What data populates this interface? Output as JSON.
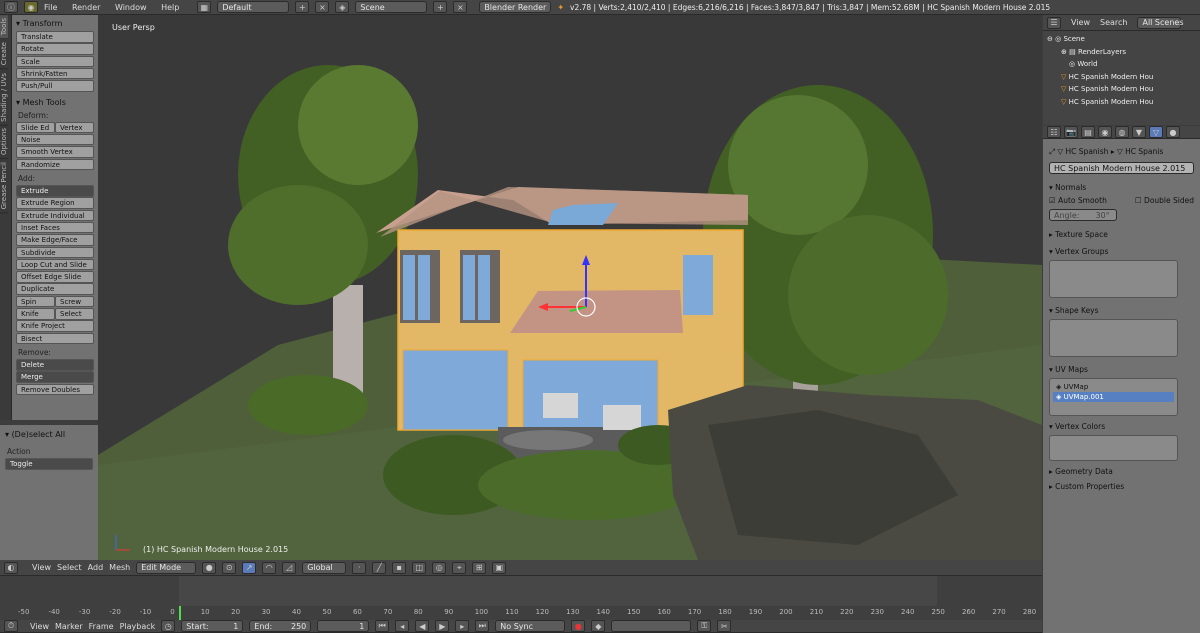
{
  "top": {
    "menus": [
      "File",
      "Render",
      "Window",
      "Help"
    ],
    "layout": "Default",
    "scene": "Scene",
    "engine": "Blender Render",
    "status": "v2.78 | Verts:2,410/2,410 | Edges:6,216/6,216 | Faces:3,847/3,847 | Tris:3,847 | Mem:52.68M | HC Spanish Modern House 2.015"
  },
  "tabs": [
    "Tools",
    "Create",
    "Shading / UVs",
    "Options",
    "Grease Pencil"
  ],
  "shelf": {
    "transform": "Transform",
    "transform_btns": [
      "Translate",
      "Rotate",
      "Scale",
      "Shrink/Fatten",
      "Push/Pull"
    ],
    "mesh_tools": "Mesh Tools",
    "deform": "Deform:",
    "slide_edge": "Slide Ed",
    "vertex": "Vertex",
    "noise": "Noise",
    "smooth_vertex": "Smooth Vertex",
    "randomize": "Randomize",
    "add": "Add:",
    "extrude": "Extrude",
    "add_btns": [
      "Extrude Region",
      "Extrude Individual",
      "Inset Faces",
      "Make Edge/Face",
      "Subdivide",
      "Loop Cut and Slide",
      "Offset Edge Slide",
      "Duplicate"
    ],
    "spin": "Spin",
    "screw": "Screw",
    "knife": "Knife",
    "select": "Select",
    "knife_project": "Knife Project",
    "bisect": "Bisect",
    "remove": "Remove:",
    "delete": "Delete",
    "merge": "Merge",
    "remove_doubles": "Remove Doubles"
  },
  "operator": {
    "title": "(De)select All",
    "action": "Action",
    "value": "Toggle"
  },
  "viewport": {
    "label": "User Persp",
    "object": "(1) HC Spanish Modern House 2.015"
  },
  "outliner": {
    "view": "View",
    "search": "Search",
    "filter": "All Scenes",
    "items": [
      "Scene",
      "RenderLayers",
      "World",
      "HC Spanish Modern Hou",
      "HC Spanish Modern Hou",
      "HC Spanish Modern Hou"
    ]
  },
  "props": {
    "breadcrumb1": "HC Spanish",
    "breadcrumb2": "HC Spanis",
    "name": "HC Spanish Modern House 2.015",
    "normals": "Normals",
    "auto_smooth": "Auto Smooth",
    "double_sided": "Double Sided",
    "angle": "Angle:",
    "angle_val": "30°",
    "texture_space": "Texture Space",
    "vertex_groups": "Vertex Groups",
    "shape_keys": "Shape Keys",
    "uv_maps": "UV Maps",
    "uvmap1": "UVMap",
    "uvmap2": "UVMap.001",
    "vertex_colors": "Vertex Colors",
    "geometry_data": "Geometry Data",
    "custom_props": "Custom Properties"
  },
  "header3d": {
    "view": "View",
    "select": "Select",
    "add": "Add",
    "mesh": "Mesh",
    "mode": "Edit Mode",
    "orient": "Global"
  },
  "timeline": {
    "ticks": [
      "-50",
      "-40",
      "-30",
      "-20",
      "-10",
      "0",
      "10",
      "20",
      "30",
      "40",
      "50",
      "60",
      "70",
      "80",
      "90",
      "100",
      "110",
      "120",
      "130",
      "140",
      "150",
      "160",
      "170",
      "180",
      "190",
      "200",
      "210",
      "220",
      "230",
      "240",
      "250",
      "260",
      "270",
      "280"
    ],
    "view": "View",
    "marker": "Marker",
    "frame": "Frame",
    "playback": "Playback",
    "start": "Start:",
    "start_val": "1",
    "end": "End:",
    "end_val": "250",
    "current": "1",
    "sync": "No Sync"
  }
}
